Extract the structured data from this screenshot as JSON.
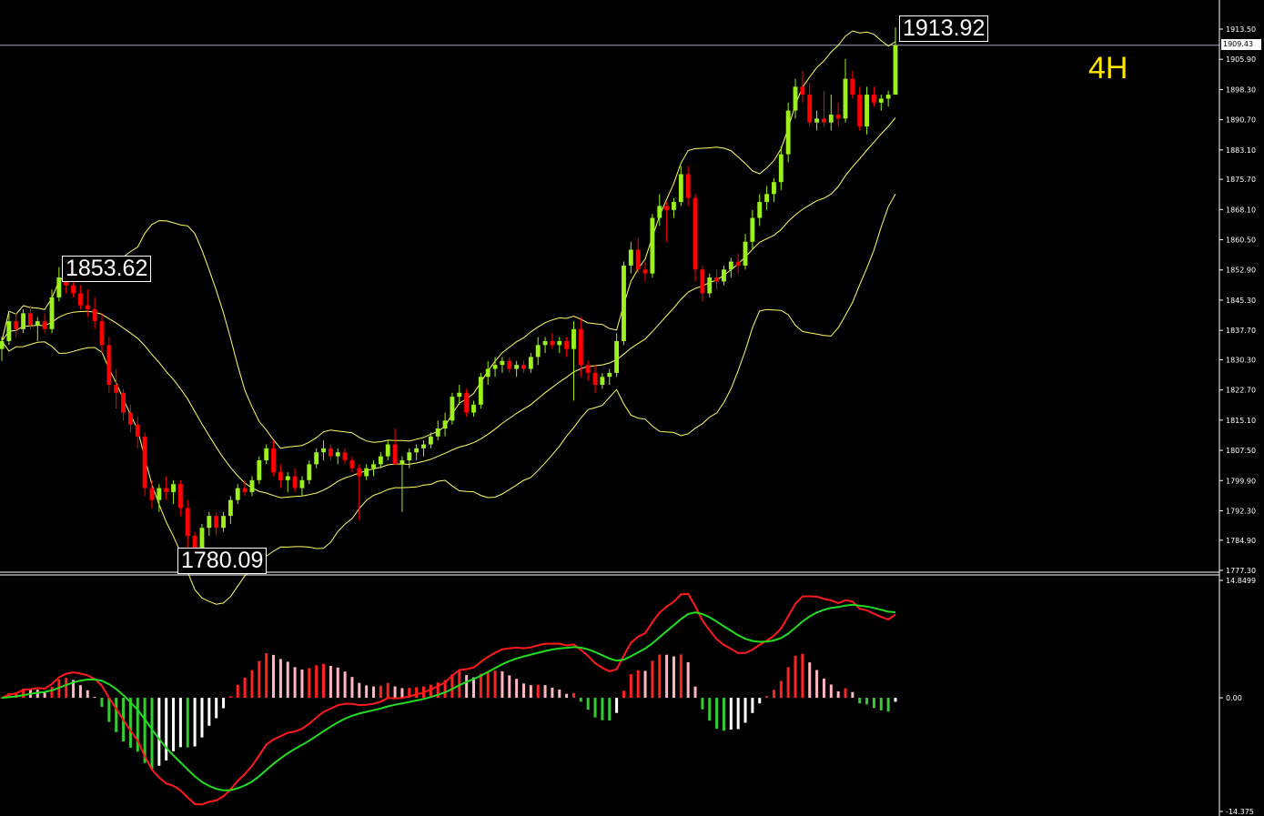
{
  "timeframe_label": "4H",
  "annotations": {
    "high_label": "1913.92",
    "left_high_label": "1853.62",
    "low_label": "1780.09"
  },
  "current_price": "1909.43",
  "colors": {
    "background": "#000000",
    "bull_candle": "#9cf01c",
    "bear_candle": "#ff0000",
    "bollinger_bands": "#ffff66",
    "macd_line": "#ff1a1a",
    "signal_line": "#22dd22",
    "hist_pos_up": "#ff2222",
    "hist_pos_down": "#ffb6c1",
    "hist_neg_down": "#33cc33",
    "hist_neg_up": "#ffffff",
    "axis_text": "#ffffff",
    "timeframe": "#ffe600"
  },
  "chart_data": [
    {
      "type": "candlestick",
      "title": "",
      "overlays": [
        "Bollinger Bands"
      ],
      "price_axis_ticks": [
        "1913.50",
        "1905.90",
        "1898.30",
        "1890.70",
        "1883.10",
        "1875.70",
        "1868.10",
        "1860.50",
        "1852.90",
        "1845.30",
        "1837.70",
        "1830.30",
        "1822.70",
        "1815.10",
        "1807.50",
        "1799.90",
        "1792.30",
        "1784.90",
        "1777.30"
      ],
      "ylim": [
        1777.3,
        1913.5
      ],
      "approx_ohlc": [
        [
          1833,
          1836,
          1830,
          1835
        ],
        [
          1835,
          1842,
          1834,
          1840
        ],
        [
          1840,
          1842,
          1836,
          1838
        ],
        [
          1838,
          1843,
          1837,
          1842
        ],
        [
          1842,
          1844,
          1838,
          1839
        ],
        [
          1839,
          1841,
          1835,
          1840
        ],
        [
          1840,
          1842,
          1837,
          1838
        ],
        [
          1838,
          1848,
          1837,
          1846
        ],
        [
          1846,
          1853.62,
          1845,
          1851
        ],
        [
          1851,
          1853,
          1847,
          1849
        ],
        [
          1849,
          1851,
          1846,
          1847
        ],
        [
          1847,
          1849,
          1843,
          1844
        ],
        [
          1844,
          1848,
          1841,
          1843
        ],
        [
          1843,
          1846,
          1838,
          1840
        ],
        [
          1840,
          1842,
          1832,
          1834
        ],
        [
          1834,
          1836,
          1822,
          1824
        ],
        [
          1824,
          1828,
          1818,
          1822
        ],
        [
          1822,
          1823,
          1815,
          1817
        ],
        [
          1817,
          1819,
          1812,
          1814
        ],
        [
          1814,
          1816,
          1808,
          1811
        ],
        [
          1811,
          1812,
          1796,
          1798
        ],
        [
          1798,
          1800,
          1793,
          1795
        ],
        [
          1795,
          1799,
          1792,
          1798
        ],
        [
          1798,
          1801,
          1795,
          1797
        ],
        [
          1797,
          1800,
          1794,
          1799
        ],
        [
          1799,
          1800,
          1791,
          1793
        ],
        [
          1793,
          1795,
          1783,
          1786
        ],
        [
          1786,
          1787,
          1780.09,
          1783
        ],
        [
          1783,
          1789,
          1782,
          1788
        ],
        [
          1788,
          1792,
          1786,
          1791
        ],
        [
          1791,
          1792,
          1786,
          1788
        ],
        [
          1788,
          1792,
          1787,
          1791
        ],
        [
          1791,
          1796,
          1789,
          1795
        ],
        [
          1795,
          1799,
          1794,
          1798
        ],
        [
          1798,
          1800,
          1796,
          1797
        ],
        [
          1797,
          1801,
          1796,
          1800
        ],
        [
          1800,
          1806,
          1799,
          1805
        ],
        [
          1805,
          1809,
          1804,
          1808
        ],
        [
          1808,
          1810,
          1801,
          1802
        ],
        [
          1802,
          1804,
          1798,
          1800
        ],
        [
          1800,
          1802,
          1797,
          1801
        ],
        [
          1801,
          1803,
          1797,
          1798
        ],
        [
          1798,
          1801,
          1796,
          1800
        ],
        [
          1800,
          1805,
          1799,
          1804
        ],
        [
          1804,
          1808,
          1803,
          1807
        ],
        [
          1807,
          1810,
          1805,
          1808
        ],
        [
          1808,
          1809,
          1805,
          1806
        ],
        [
          1806,
          1808,
          1804,
          1807
        ],
        [
          1807,
          1808,
          1804,
          1805
        ],
        [
          1805,
          1806,
          1802,
          1803
        ],
        [
          1803,
          1804,
          1790,
          1801
        ],
        [
          1801,
          1804,
          1800,
          1803
        ],
        [
          1803,
          1805,
          1801,
          1804
        ],
        [
          1804,
          1807,
          1803,
          1806
        ],
        [
          1806,
          1810,
          1805,
          1809
        ],
        [
          1809,
          1813,
          1807,
          1804
        ],
        [
          1804,
          1806,
          1792,
          1805
        ],
        [
          1805,
          1808,
          1803,
          1807
        ],
        [
          1807,
          1809,
          1805,
          1808
        ],
        [
          1808,
          1810,
          1806,
          1809
        ],
        [
          1809,
          1812,
          1808,
          1811
        ],
        [
          1811,
          1815,
          1810,
          1813
        ],
        [
          1813,
          1817,
          1811,
          1815
        ],
        [
          1815,
          1822,
          1814,
          1821
        ],
        [
          1821,
          1824,
          1819,
          1822
        ],
        [
          1822,
          1823,
          1816,
          1817
        ],
        [
          1817,
          1820,
          1816,
          1819
        ],
        [
          1819,
          1827,
          1818,
          1826
        ],
        [
          1826,
          1830,
          1824,
          1828
        ],
        [
          1828,
          1831,
          1826,
          1829
        ],
        [
          1829,
          1831,
          1827,
          1830
        ],
        [
          1830,
          1831,
          1827,
          1828
        ],
        [
          1828,
          1830,
          1826,
          1829
        ],
        [
          1829,
          1830,
          1827,
          1828
        ],
        [
          1828,
          1832,
          1827,
          1831
        ],
        [
          1831,
          1836,
          1829,
          1834
        ],
        [
          1834,
          1836,
          1832,
          1835
        ],
        [
          1835,
          1837,
          1833,
          1834
        ],
        [
          1834,
          1836,
          1832,
          1835
        ],
        [
          1835,
          1836,
          1831,
          1833
        ],
        [
          1833,
          1840,
          1820,
          1838
        ],
        [
          1838,
          1841,
          1826,
          1829
        ],
        [
          1829,
          1830,
          1825,
          1827
        ],
        [
          1827,
          1829,
          1822,
          1824
        ],
        [
          1824,
          1827,
          1823,
          1826
        ],
        [
          1826,
          1828,
          1824,
          1827
        ],
        [
          1827,
          1837,
          1826,
          1835
        ],
        [
          1835,
          1855,
          1834,
          1854
        ],
        [
          1854,
          1860,
          1852,
          1858
        ],
        [
          1858,
          1861,
          1852,
          1853
        ],
        [
          1853,
          1855,
          1850,
          1852
        ],
        [
          1852,
          1867,
          1851,
          1866
        ],
        [
          1866,
          1872,
          1864,
          1869
        ],
        [
          1869,
          1870,
          1860,
          1868
        ],
        [
          1868,
          1871,
          1866,
          1870
        ],
        [
          1870,
          1879,
          1869,
          1877
        ],
        [
          1877,
          1879,
          1869,
          1871
        ],
        [
          1871,
          1872,
          1850,
          1853
        ],
        [
          1853,
          1854,
          1845,
          1847
        ],
        [
          1847,
          1852,
          1846,
          1851
        ],
        [
          1851,
          1853,
          1848,
          1850
        ],
        [
          1850,
          1854,
          1849,
          1853
        ],
        [
          1853,
          1856,
          1851,
          1855
        ],
        [
          1855,
          1857,
          1852,
          1854
        ],
        [
          1854,
          1862,
          1853,
          1860
        ],
        [
          1860,
          1868,
          1858,
          1866
        ],
        [
          1866,
          1872,
          1864,
          1870
        ],
        [
          1870,
          1874,
          1868,
          1872
        ],
        [
          1872,
          1876,
          1870,
          1875
        ],
        [
          1875,
          1884,
          1873,
          1882
        ],
        [
          1882,
          1895,
          1880,
          1893
        ],
        [
          1893,
          1901,
          1891,
          1899
        ],
        [
          1899,
          1903,
          1895,
          1897
        ],
        [
          1897,
          1900,
          1889,
          1890
        ],
        [
          1890,
          1893,
          1888,
          1891
        ],
        [
          1891,
          1898,
          1889,
          1890
        ],
        [
          1890,
          1897,
          1888,
          1892
        ],
        [
          1892,
          1895,
          1889,
          1891
        ],
        [
          1891,
          1906,
          1890,
          1901
        ],
        [
          1901,
          1903,
          1896,
          1897
        ],
        [
          1897,
          1899,
          1888,
          1889
        ],
        [
          1889,
          1899,
          1887,
          1897
        ],
        [
          1897,
          1899,
          1894,
          1895
        ],
        [
          1895,
          1897,
          1893,
          1896
        ],
        [
          1896,
          1898,
          1894,
          1897
        ],
        [
          1897,
          1913.92,
          1903,
          1909.43
        ]
      ]
    },
    {
      "type": "macd",
      "title": "",
      "axis_ticks": [
        "14.8499",
        "0.00",
        "-14.375"
      ],
      "ylim": [
        -14.375,
        14.8499
      ]
    }
  ]
}
